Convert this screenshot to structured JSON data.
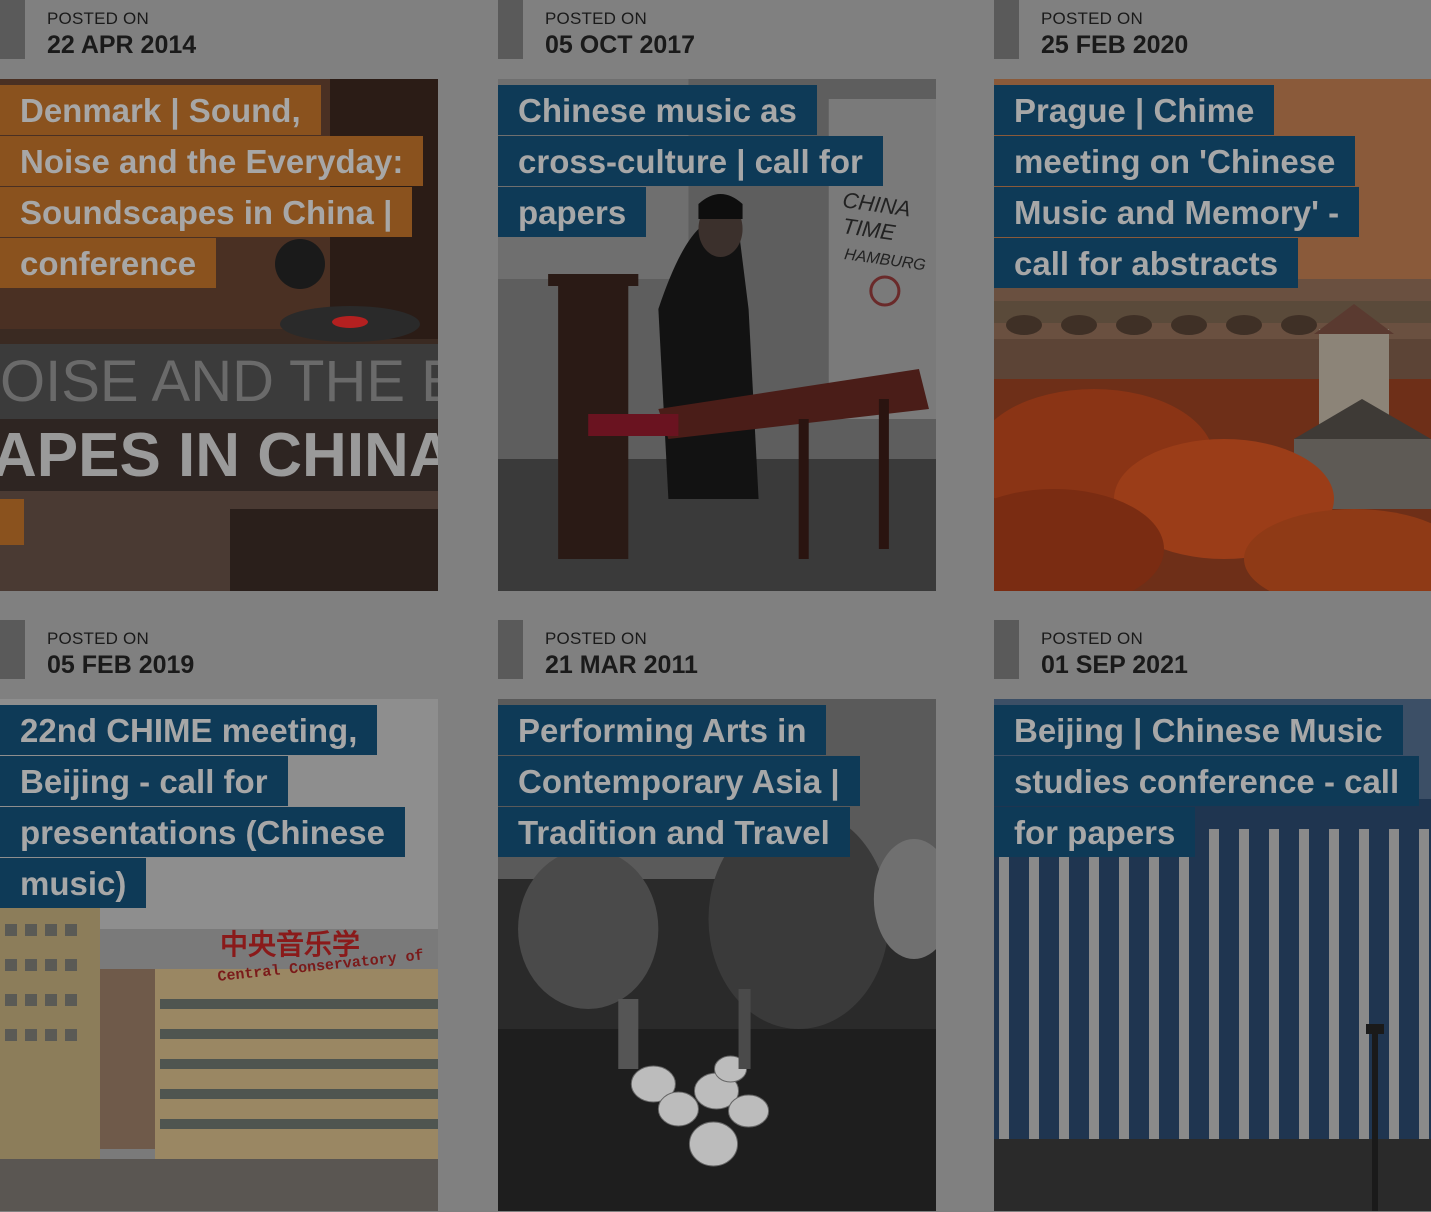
{
  "posts": [
    {
      "posted_label": "POSTED ON",
      "date": "22 APR 2014",
      "title_lines": [
        "Denmark | Sound,",
        "Noise and the Everyday:",
        "Soundscapes in China |",
        "conference"
      ],
      "image_text": [
        "OISE AND THE E",
        "APES IN CHINA"
      ],
      "accent": "#8a521e"
    },
    {
      "posted_label": "POSTED ON",
      "date": "05 OCT 2017",
      "title_lines": [
        "Chinese music as",
        "cross-culture | call for",
        "papers"
      ],
      "image_text": [
        "CHINA",
        "TIME",
        "HAMBURG"
      ],
      "accent": "#0e3a57"
    },
    {
      "posted_label": "POSTED ON",
      "date": "25 FEB 2020",
      "title_lines": [
        "Prague | Chime",
        "meeting on 'Chinese",
        "Music and Memory' -",
        "call for abstracts"
      ],
      "accent": "#0e3a57"
    },
    {
      "posted_label": "POSTED ON",
      "date": "05 FEB 2019",
      "title_lines": [
        "22nd CHIME meeting,",
        "Beijing - call for",
        "presentations (Chinese",
        "music)"
      ],
      "image_text": [
        "中央音乐学",
        "Central Conservatory of"
      ],
      "accent": "#0e3a57"
    },
    {
      "posted_label": "POSTED ON",
      "date": "21 MAR 2011",
      "title_lines": [
        "Performing Arts in",
        "Contemporary Asia |",
        "Tradition and Travel"
      ],
      "accent": "#0e3a57"
    },
    {
      "posted_label": "POSTED ON",
      "date": "01 SEP 2021",
      "title_lines": [
        "Beijing | Chinese Music",
        "studies conference - call",
        "for papers"
      ],
      "accent": "#0e3a57"
    }
  ]
}
